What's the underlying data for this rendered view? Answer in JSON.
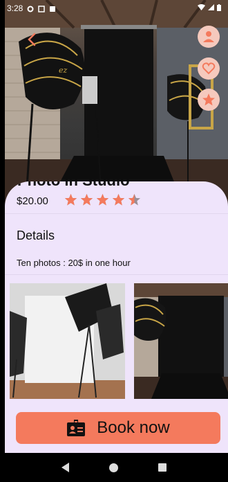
{
  "status_bar": {
    "time": "3:28",
    "icons": [
      "gear-icon",
      "sim-icon",
      "clock-icon"
    ],
    "right_icons": [
      "wifi-icon",
      "signal-icon",
      "battery-icon"
    ]
  },
  "header": {
    "back_icon": "chevron-left-icon",
    "actions": [
      "profile-icon",
      "heart-icon",
      "star-icon"
    ]
  },
  "listing": {
    "title": "Photo in Studio",
    "price": "$20.00",
    "rating": 4.5,
    "rating_max": 5,
    "details_heading": "Details",
    "details_text": "Ten photos : 20$ in one hour"
  },
  "gallery": {
    "items": [
      "studio-softbox-photo",
      "studio-backdrop-photo"
    ]
  },
  "action": {
    "book_label": "Book now",
    "book_icon": "badge-icon"
  },
  "colors": {
    "accent": "#f47a5d",
    "sheet_bg": "#efe4fb",
    "star": "#f47a5d",
    "fab_bg": "#f5c9bd"
  }
}
